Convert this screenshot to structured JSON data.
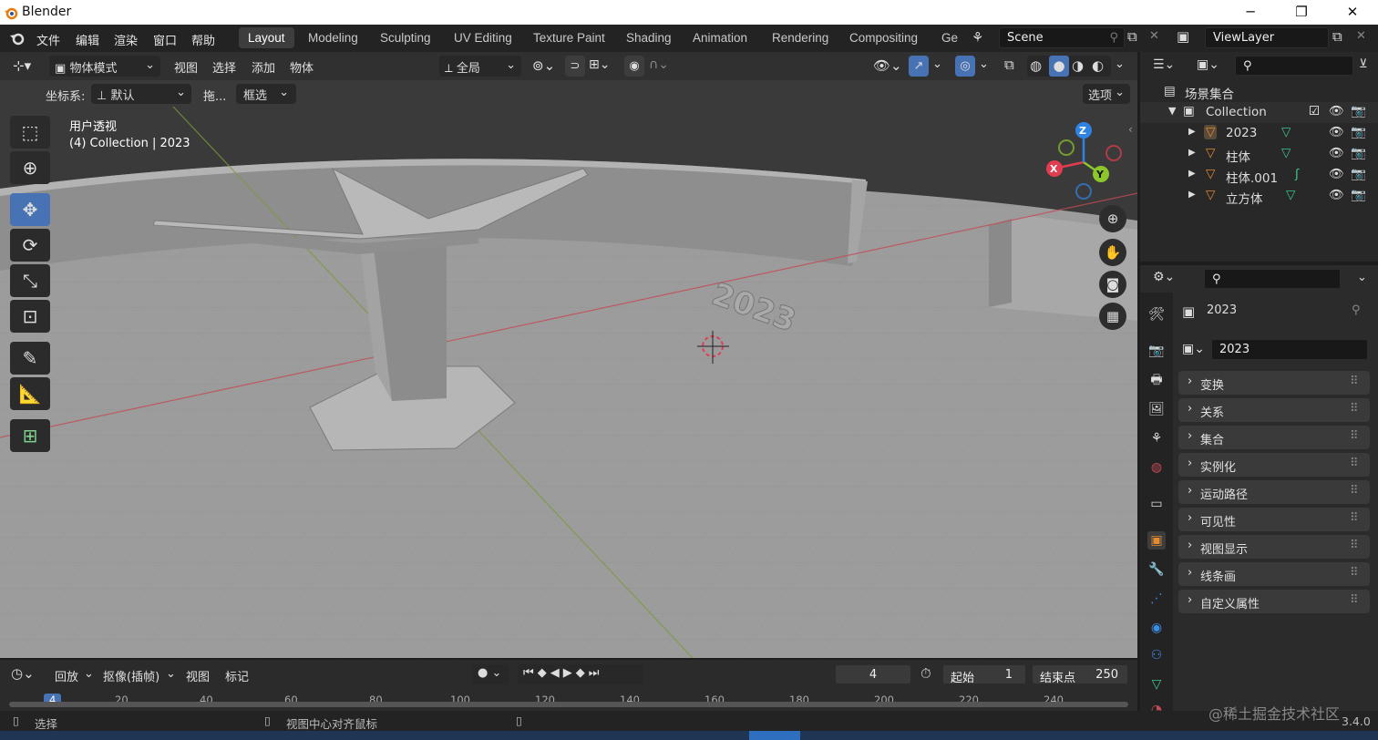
{
  "titlebar": {
    "title": "Blender",
    "minimize": "─",
    "maximize": "❐",
    "close": "✕"
  },
  "menubar": {
    "items": [
      "文件",
      "编辑",
      "渲染",
      "窗口",
      "帮助"
    ]
  },
  "workspaces": [
    "Layout",
    "Modeling",
    "Sculpting",
    "UV Editing",
    "Texture Paint",
    "Shading",
    "Animation",
    "Rendering",
    "Compositing",
    "Ge"
  ],
  "scene": {
    "label": "Scene"
  },
  "viewlayer": {
    "label": "ViewLayer"
  },
  "viewport_header": {
    "mode": "物体模式",
    "menus": [
      "视图",
      "选择",
      "添加",
      "物体"
    ],
    "orientation": "全局",
    "coord_label": "坐标系:",
    "coord_value": "默认",
    "drag_label": "拖...",
    "drag_value": "框选",
    "options": "选项"
  },
  "viewport": {
    "view_name": "用户透视",
    "collection_info": "(4) Collection | 2023",
    "text_object": "2023",
    "axes": {
      "x": "X",
      "y": "Y",
      "z": "Z"
    }
  },
  "outliner": {
    "root": "场景集合",
    "collection": "Collection",
    "objects": [
      "2023",
      "柱体",
      "柱体.001",
      "立方体"
    ]
  },
  "properties": {
    "object_name": "2023",
    "data_name": "2023",
    "panels": [
      "变换",
      "关系",
      "集合",
      "实例化",
      "运动路径",
      "可见性",
      "视图显示",
      "线条画",
      "自定义属性"
    ]
  },
  "timeline": {
    "menus": [
      "回放",
      "抠像(插帧)",
      "视图",
      "标记"
    ],
    "current_frame": "4",
    "start_label": "起始",
    "start_value": "1",
    "end_label": "结束点",
    "end_value": "250",
    "ruler": [
      "4",
      "20",
      "40",
      "60",
      "80",
      "100",
      "120",
      "140",
      "160",
      "180",
      "200",
      "220",
      "240"
    ]
  },
  "statusbar": {
    "left": "选择",
    "middle": "视图中心对齐鼠标",
    "version": "3.4.0",
    "watermark": "@稀土掘金技术社区"
  },
  "colors": {
    "accent": "#4772b3",
    "x_axis": "#e23c50",
    "y_axis": "#8bc72b",
    "z_axis": "#2f84e3",
    "object_orange": "#e38a2e",
    "mesh_green": "#3dc88c"
  }
}
